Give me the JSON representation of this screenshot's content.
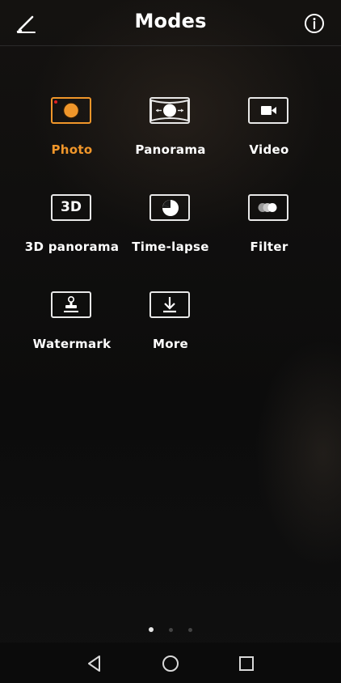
{
  "header": {
    "title": "Modes"
  },
  "icons": {
    "edit": "edit-pencil-icon",
    "info": "info-icon"
  },
  "modes": [
    {
      "label": "Photo",
      "icon": "photo-icon",
      "active": true
    },
    {
      "label": "Panorama",
      "icon": "panorama-icon",
      "active": false
    },
    {
      "label": "Video",
      "icon": "video-icon",
      "active": false
    },
    {
      "label": "3D panorama",
      "icon": "3d-panorama-icon",
      "active": false,
      "icon_text": "3D"
    },
    {
      "label": "Time-lapse",
      "icon": "time-lapse-icon",
      "active": false
    },
    {
      "label": "Filter",
      "icon": "filter-icon",
      "active": false
    },
    {
      "label": "Watermark",
      "icon": "watermark-icon",
      "active": false
    },
    {
      "label": "More",
      "icon": "download-more-icon",
      "active": false
    }
  ],
  "pager": {
    "pages": 3,
    "current": 1
  },
  "navbar": {
    "back": "back-triangle-icon",
    "home": "home-circle-icon",
    "recents": "recents-square-icon"
  },
  "colors": {
    "accent": "#f0962a",
    "background": "#0f0f0f",
    "text": "#ffffff",
    "recording_dot": "#e02020"
  }
}
